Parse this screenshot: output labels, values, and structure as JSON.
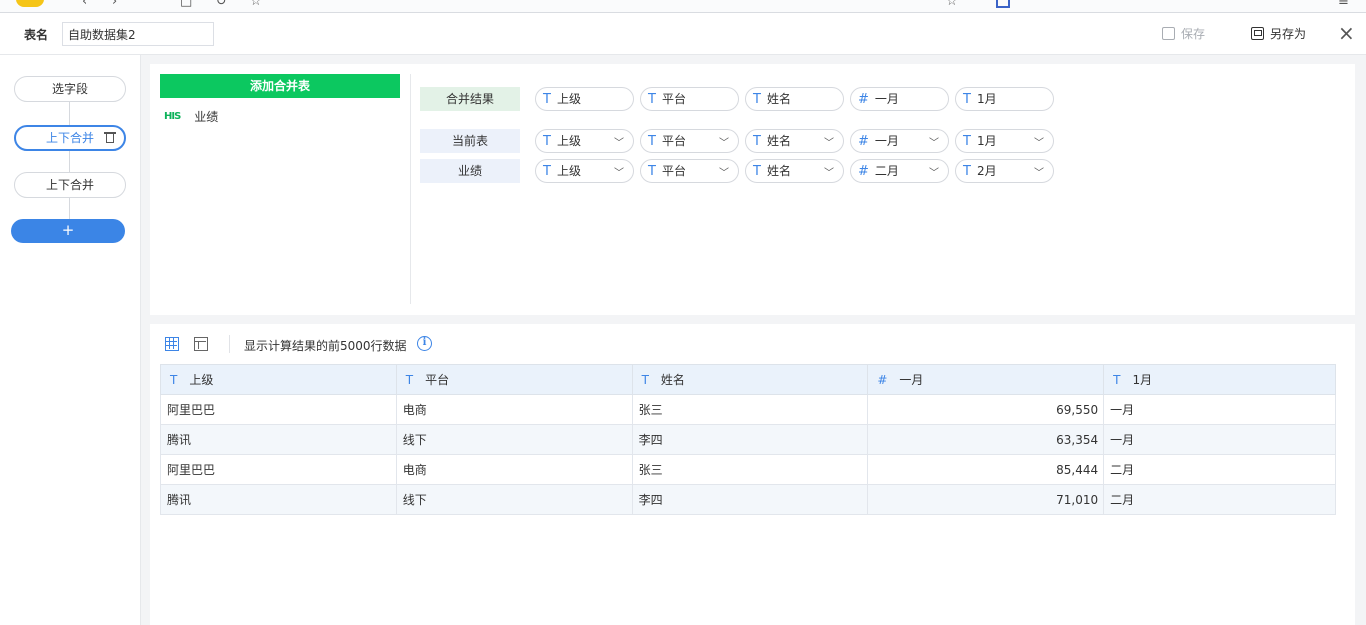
{
  "header": {
    "table_name_label": "表名",
    "table_name_value": "自助数据集2",
    "save_label": "保存",
    "save_as_label": "另存为",
    "close_glyph": "×"
  },
  "steps": {
    "select_fields": "选字段",
    "merge_1": "上下合并",
    "merge_2": "上下合并",
    "add": "+"
  },
  "config": {
    "add_merge_label": "添加合并表",
    "table_item": "业绩",
    "table_item_icon": "HIS",
    "rows": [
      {
        "label": "合并结果",
        "fields": [
          {
            "type": "T",
            "name": "上级"
          },
          {
            "type": "T",
            "name": "平台"
          },
          {
            "type": "T",
            "name": "姓名"
          },
          {
            "type": "#",
            "name": "一月"
          },
          {
            "type": "T",
            "name": "1月"
          }
        ]
      },
      {
        "label": "当前表",
        "fields": [
          {
            "type": "T",
            "name": "上级"
          },
          {
            "type": "T",
            "name": "平台"
          },
          {
            "type": "T",
            "name": "姓名"
          },
          {
            "type": "#",
            "name": "一月"
          },
          {
            "type": "T",
            "name": "1月"
          }
        ]
      },
      {
        "label": "业绩",
        "fields": [
          {
            "type": "T",
            "name": "上级"
          },
          {
            "type": "T",
            "name": "平台"
          },
          {
            "type": "T",
            "name": "姓名"
          },
          {
            "type": "#",
            "name": "二月"
          },
          {
            "type": "T",
            "name": "2月"
          }
        ]
      }
    ]
  },
  "preview": {
    "hint": "显示计算结果的前5000行数据",
    "info_glyph": "i",
    "columns": [
      {
        "type": "T",
        "name": "上级"
      },
      {
        "type": "T",
        "name": "平台"
      },
      {
        "type": "T",
        "name": "姓名"
      },
      {
        "type": "#",
        "name": "一月"
      },
      {
        "type": "T",
        "name": "1月"
      }
    ],
    "rows": [
      [
        "阿里巴巴",
        "电商",
        "张三",
        "69,550",
        "一月"
      ],
      [
        "腾讯",
        "线下",
        "李四",
        "63,354",
        "一月"
      ],
      [
        "阿里巴巴",
        "电商",
        "张三",
        "85,444",
        "二月"
      ],
      [
        "腾讯",
        "线下",
        "李四",
        "71,010",
        "二月"
      ]
    ]
  },
  "colors": {
    "primary_blue": "#3b85e6",
    "green": "#0cc860",
    "result_bg": "#e3f2e7",
    "row_label_bg": "#ecf1fa"
  }
}
